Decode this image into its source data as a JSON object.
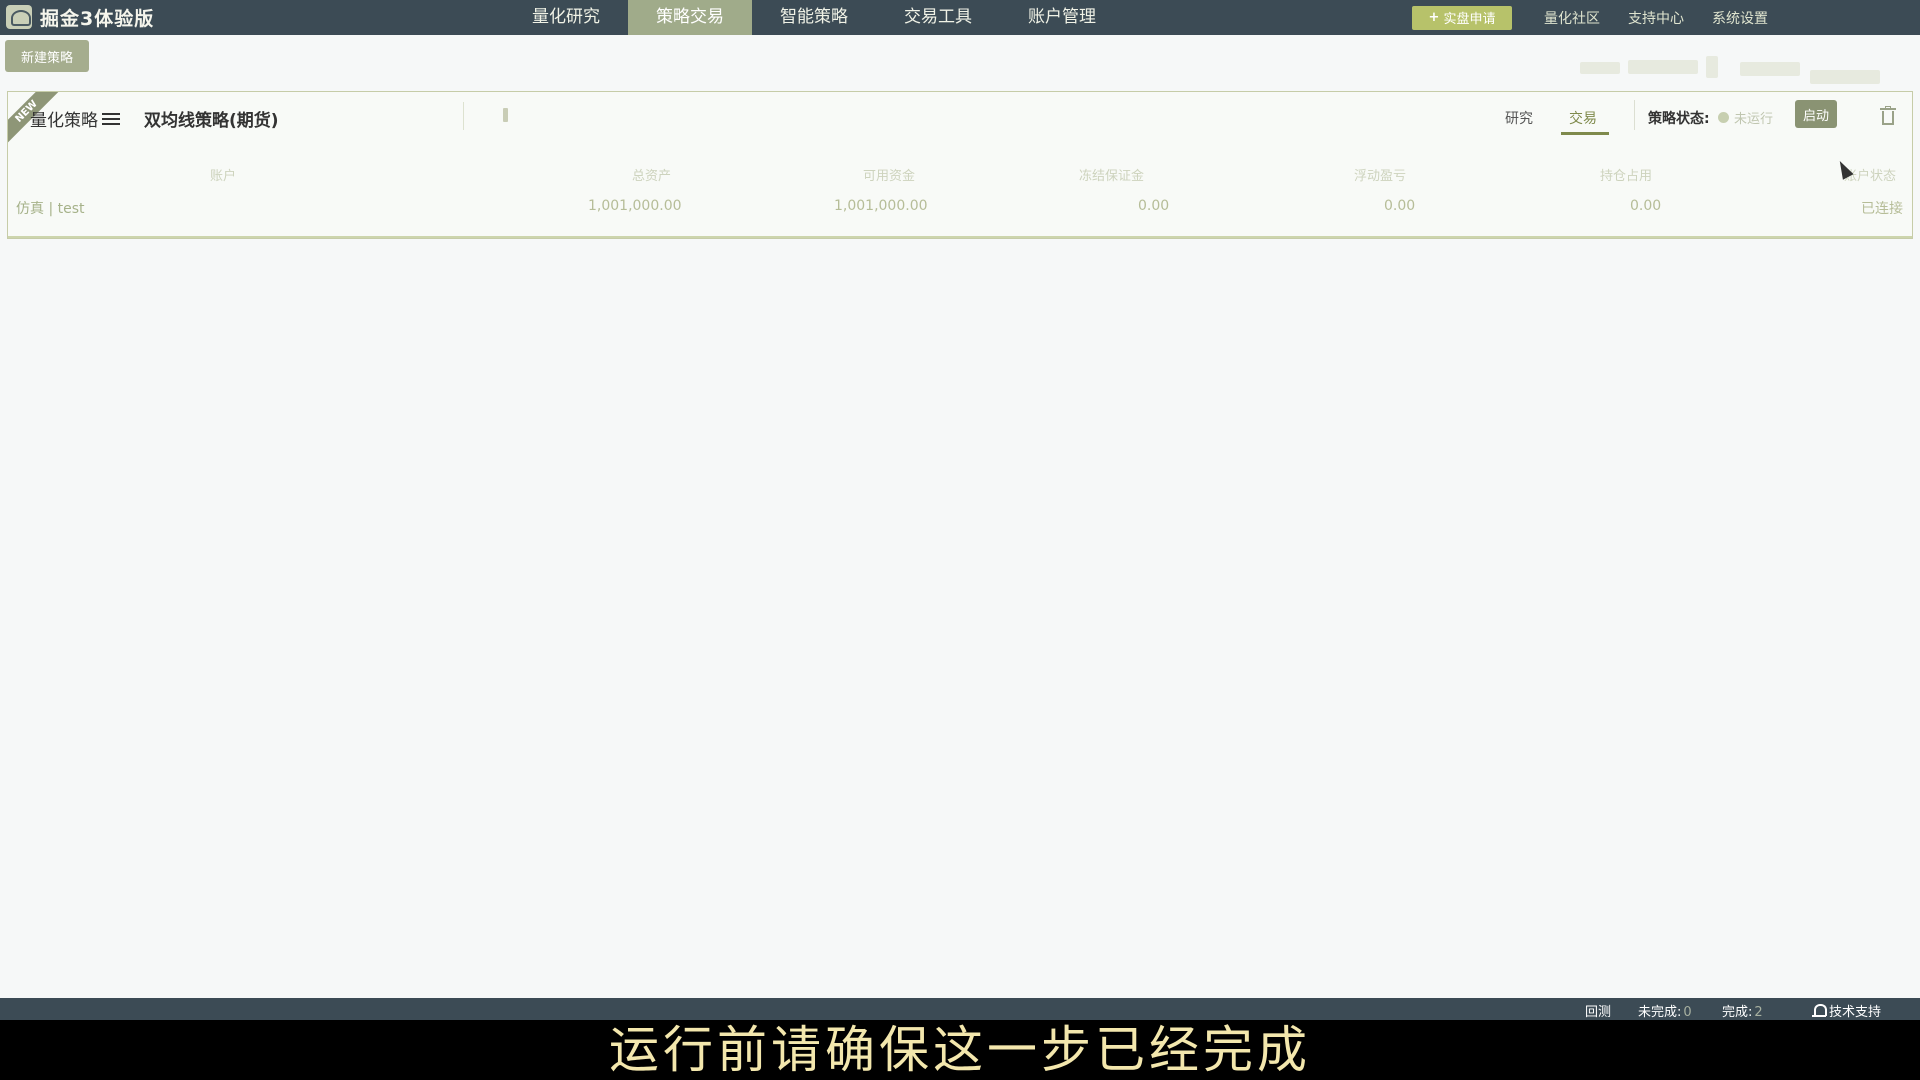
{
  "app": {
    "title": "掘金3体验版"
  },
  "nav": {
    "tabs": [
      "量化研究",
      "策略交易",
      "智能策略",
      "交易工具",
      "账户管理"
    ],
    "active_index": 1,
    "live_button": "实盘申请",
    "links": [
      "量化社区",
      "支持中心",
      "系统设置"
    ]
  },
  "toolbar": {
    "new_strategy": "新建策略"
  },
  "card": {
    "badge": "NEW",
    "category": "量化策略",
    "name": "双均线策略(期货)",
    "tabs": {
      "research": "研究",
      "trade": "交易",
      "active": "trade"
    },
    "status_label": "策略状态:",
    "status_value": "未运行",
    "start_button": "启动",
    "table": {
      "headers": [
        "账户",
        "总资产",
        "可用资金",
        "冻结保证金",
        "浮动盈亏",
        "持仓占用",
        "账户状态"
      ],
      "row": {
        "account": "仿真 | test",
        "total_assets": "1,001,000.00",
        "available": "1,001,000.00",
        "frozen_margin": "0.00",
        "floating_pnl": "0.00",
        "position_used": "0.00",
        "account_status": "已连接"
      }
    }
  },
  "statusbar": {
    "backtest": "回测",
    "unfinished_label": "未完成:",
    "unfinished_count": "0",
    "finished_label": "完成:",
    "finished_count": "2",
    "support": "技术支持"
  },
  "subtitle": "运行前请确保这一步已经完成",
  "colors": {
    "nav_bg": "#3c4b55",
    "accent": "#a0ab8a",
    "accent_dark": "#7f8a4c",
    "subtitle": "#f3e7ad"
  }
}
